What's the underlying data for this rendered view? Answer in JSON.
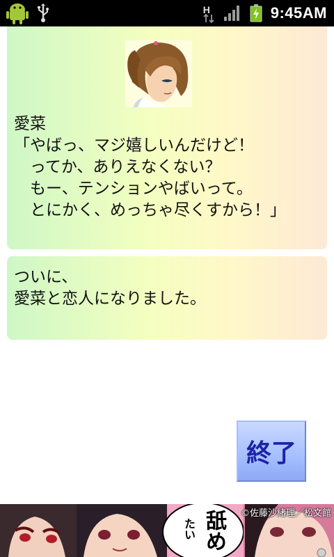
{
  "status_bar": {
    "time": "9:45AM",
    "network_label": "H",
    "icons": [
      "android-icon",
      "usb-icon",
      "h-network-icon",
      "signal-icon",
      "battery-charging-icon"
    ]
  },
  "dialog_card": {
    "speaker": "愛菜",
    "line1": "「やばっ、マジ嬉しいんだけど！",
    "line2": "　ってか、ありえなくない？",
    "line3": "　もー、テンションやばいって。",
    "line4": "　とにかく、めっちゃ尽くすから！」"
  },
  "narration_card": {
    "line1": "ついに、",
    "line2": "愛菜と恋人になりました。"
  },
  "end_button": {
    "label": "終了"
  },
  "banner": {
    "credit": "©佐藤沙緒理／松文館",
    "bubble_big": "舐め",
    "bubble_small": "たい"
  }
}
